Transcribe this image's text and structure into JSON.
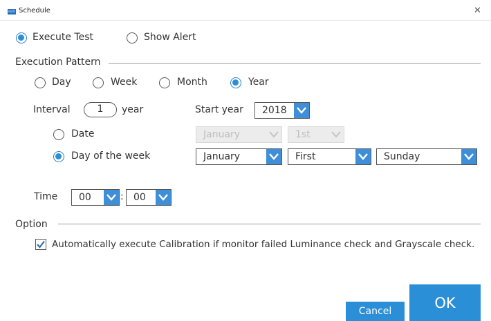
{
  "window": {
    "title": "Schedule",
    "app_icon_text": "EIZO"
  },
  "mode": {
    "execute_test": "Execute Test",
    "show_alert": "Show Alert",
    "selected": "execute_test"
  },
  "execution_pattern": {
    "section_label": "Execution Pattern",
    "options": [
      "Day",
      "Week",
      "Month",
      "Year"
    ],
    "selected": "Year",
    "interval_label": "Interval",
    "interval_value": "1",
    "interval_unit": "year",
    "start_year_label": "Start year",
    "start_year_value": "2018",
    "date_label": "Date",
    "date_month": "January",
    "date_day": "1st",
    "day_of_week_label": "Day of the week",
    "dow_month": "January",
    "dow_ordinal": "First",
    "dow_day": "Sunday",
    "sub_selected": "day_of_week"
  },
  "time": {
    "label": "Time",
    "hour": "00",
    "separator": ":",
    "minute": "00"
  },
  "option": {
    "section_label": "Option",
    "auto_calibration_label": "Automatically execute Calibration if monitor failed Luminance check and Grayscale check.",
    "auto_calibration_checked": true
  },
  "buttons": {
    "cancel": "Cancel",
    "ok": "OK"
  },
  "colors": {
    "accent": "#2a8fd6",
    "disabled_bg": "#ececec"
  }
}
